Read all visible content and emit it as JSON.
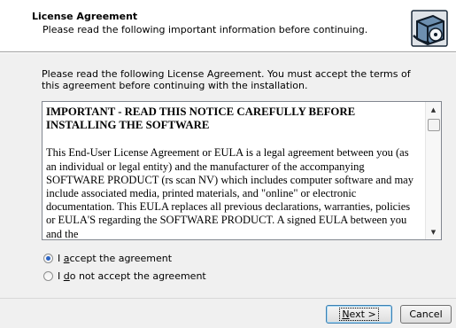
{
  "header": {
    "title": "License Agreement",
    "subtitle": "Please read the following important information before continuing.",
    "icon": "installer-box-icon"
  },
  "intro": "Please read the following License Agreement. You must accept the terms of this agreement before continuing with the installation.",
  "eula": {
    "heading": "IMPORTANT - READ THIS NOTICE CAREFULLY BEFORE INSTALLING THE SOFTWARE",
    "body": "This End-User License Agreement or EULA is a legal agreement between you (as an individual or legal entity) and the manufacturer of the accompanying SOFTWARE PRODUCT (rs scan NV) which includes computer software and may include associated media, printed materials, and \"online\" or electronic documentation. This EULA replaces all previous declarations, warranties, policies or EULA'S regarding the SOFTWARE PRODUCT. A signed EULA between you and the"
  },
  "options": {
    "accept_label_pre": "I ",
    "accept_label_u": "a",
    "accept_label_post": "ccept the agreement",
    "decline_label_pre": "I ",
    "decline_label_u": "d",
    "decline_label_post": "o not accept the agreement",
    "selected": "accept"
  },
  "buttons": {
    "next_u": "N",
    "next_rest": "ext >",
    "cancel": "Cancel"
  },
  "colors": {
    "accent": "#2a63c3",
    "window_bg": "#f0f0f0"
  }
}
